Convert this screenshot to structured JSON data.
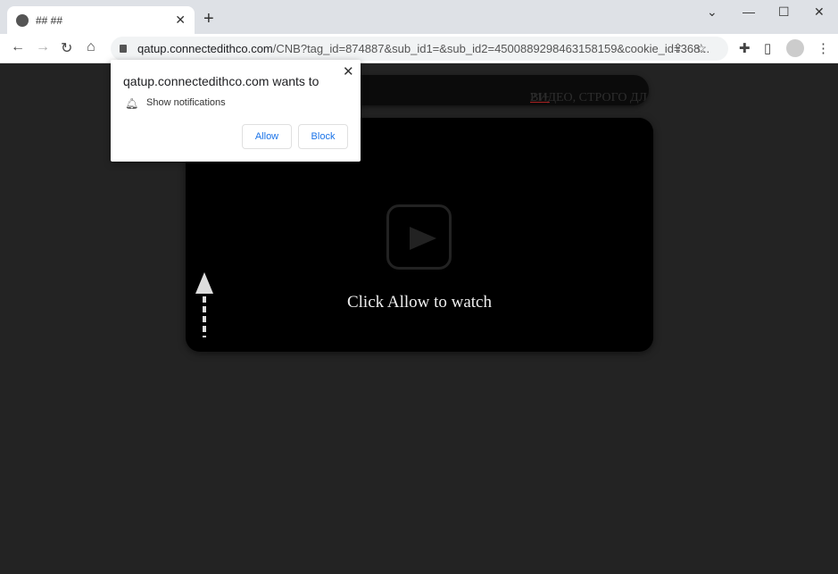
{
  "browser": {
    "tab_title": "## ##",
    "url_host": "qatup.connectedithco.com",
    "url_rest": "/CNB?tag_id=874887&sub_id1=&sub_id2=4500889298463158159&cookie_id=368..."
  },
  "popup": {
    "title": "qatup.connectedithco.com wants to",
    "permission": "Show notifications",
    "allow_label": "Allow",
    "block_label": "Block"
  },
  "page": {
    "banner_text": "ВИДЕО, СТРОГО ДЛЯ ТЕХ, КОМУ ",
    "banner_age": "21+",
    "cta": "Click Allow to watch"
  }
}
